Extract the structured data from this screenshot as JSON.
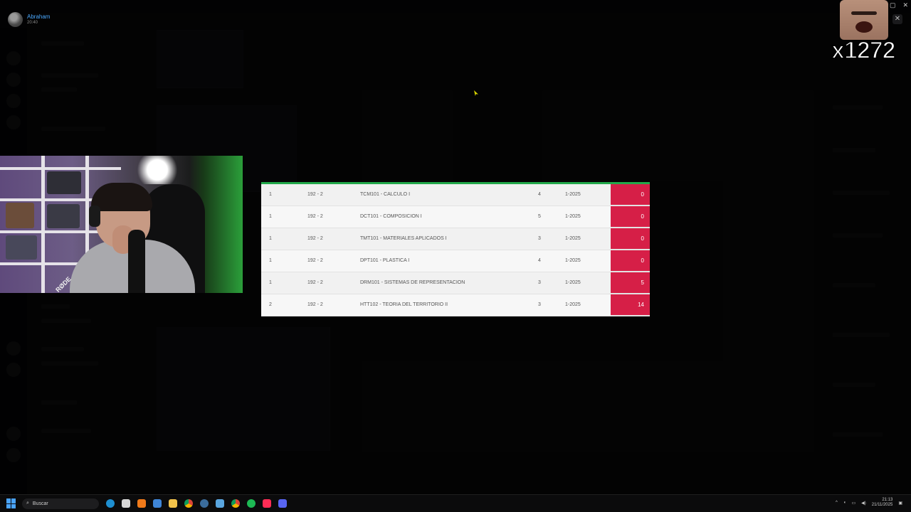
{
  "user": {
    "name": "Abraham",
    "time": "20:40"
  },
  "grades_table": {
    "rows": [
      {
        "semester": "1",
        "group": "192 - 2",
        "subject": "TCM101 - CALCULO I",
        "credits": "4",
        "period": "1-2025",
        "score": "0"
      },
      {
        "semester": "1",
        "group": "192 - 2",
        "subject": "DCT101 - COMPOSICION I",
        "credits": "5",
        "period": "1-2025",
        "score": "0"
      },
      {
        "semester": "1",
        "group": "192 - 2",
        "subject": "TMT101 - MATERIALES APLICADOS I",
        "credits": "3",
        "period": "1-2025",
        "score": "0"
      },
      {
        "semester": "1",
        "group": "192 - 2",
        "subject": "DPT101 - PLASTICA I",
        "credits": "4",
        "period": "1-2025",
        "score": "0"
      },
      {
        "semester": "1",
        "group": "192 - 2",
        "subject": "DRM101 - SISTEMAS DE REPRESENTACION",
        "credits": "3",
        "period": "1-2025",
        "score": "5"
      },
      {
        "semester": "2",
        "group": "192 - 2",
        "subject": "HTT102 - TEORIA DEL TERRITORIO II",
        "credits": "3",
        "period": "1-2025",
        "score": "14"
      }
    ],
    "score_color": "#d61f47",
    "accent_color": "#22a84a"
  },
  "webcam": {
    "mic_brand": "RØDE"
  },
  "emote": {
    "count": "x1272"
  },
  "taskbar": {
    "search_placeholder": "Buscar",
    "time": "21:13",
    "date": "21/11/2025",
    "icons": [
      "windows-start-icon",
      "edge-icon",
      "store-icon",
      "app-icon",
      "folder-icon",
      "chrome-icon",
      "steam-icon",
      "mail-icon",
      "spotify-icon",
      "tiktok-icon",
      "discord-icon"
    ]
  },
  "viewer": {
    "icons": [
      "search-icon",
      "close-icon"
    ]
  }
}
